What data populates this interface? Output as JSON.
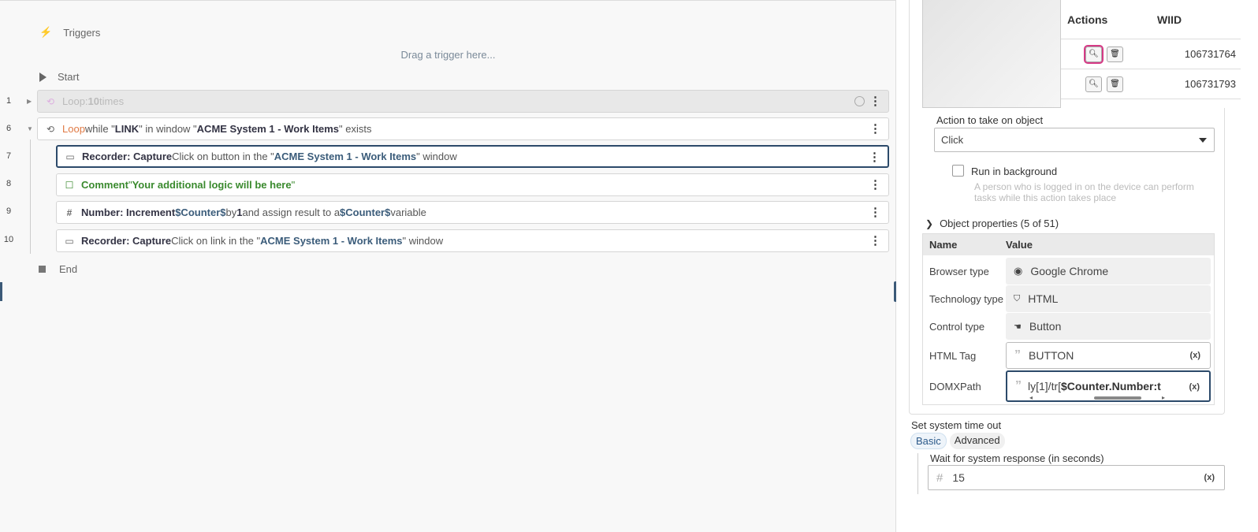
{
  "canvas": {
    "triggers_label": "Triggers",
    "drag_hint": "Drag a trigger here...",
    "start_label": "Start",
    "end_label": "End",
    "steps": [
      {
        "line": "1",
        "parts": [
          "Loop",
          " : ",
          "10",
          " times"
        ]
      },
      {
        "line": "6",
        "parts": [
          "Loop",
          " while \"",
          "LINK",
          "\" in window \"",
          "ACME System 1 - Work Items",
          "\" exists"
        ]
      },
      {
        "line": "7",
        "parts": [
          "Recorder: Capture",
          " Click on button in the \"",
          "ACME System 1 - Work Items",
          "\" window"
        ]
      },
      {
        "line": "8",
        "parts": [
          "Comment",
          " \"",
          "Your additional logic will be here",
          "\""
        ]
      },
      {
        "line": "9",
        "parts": [
          "Number: Increment",
          " ",
          "$Counter$",
          " by ",
          "1",
          " and assign result to a ",
          "$Counter$",
          " variable"
        ]
      },
      {
        "line": "10",
        "parts": [
          "Recorder: Capture",
          " Click on link in the \"",
          "ACME System 1 - Work Items",
          "\" window"
        ]
      }
    ]
  },
  "panel": {
    "work_items": {
      "headers": [
        "Actions",
        "WIID"
      ],
      "rows": [
        {
          "wiid": "106731764"
        },
        {
          "wiid": "106731793"
        }
      ]
    },
    "action_label": "Action to take on object",
    "action_value": "Click",
    "run_bg_label": "Run in background",
    "run_bg_hint": "A person who is logged in on the device can perform tasks while this action takes place",
    "object_props_label": "Object properties (5 of 51)",
    "props_headers": [
      "Name",
      "Value"
    ],
    "props": [
      {
        "name": "Browser type",
        "value": "Google Chrome"
      },
      {
        "name": "Technology type",
        "value": "HTML"
      },
      {
        "name": "Control type",
        "value": "Button"
      },
      {
        "name": "HTML Tag",
        "value": "BUTTON"
      },
      {
        "name": "DOMXPath",
        "value_prefix": "ly[1]/tr[",
        "value_bold": "$Counter.Number:t"
      }
    ],
    "var_token": "(x)",
    "timeout_label": "Set system time out",
    "tabs": [
      "Basic",
      "Advanced"
    ],
    "wait_label": "Wait for system response (in seconds)",
    "wait_value": "15",
    "colors": {
      "accent": "#2c4a6a",
      "loop": "#c65fcf",
      "comment": "#3a8a2e",
      "highlight": "#d63a86"
    }
  }
}
